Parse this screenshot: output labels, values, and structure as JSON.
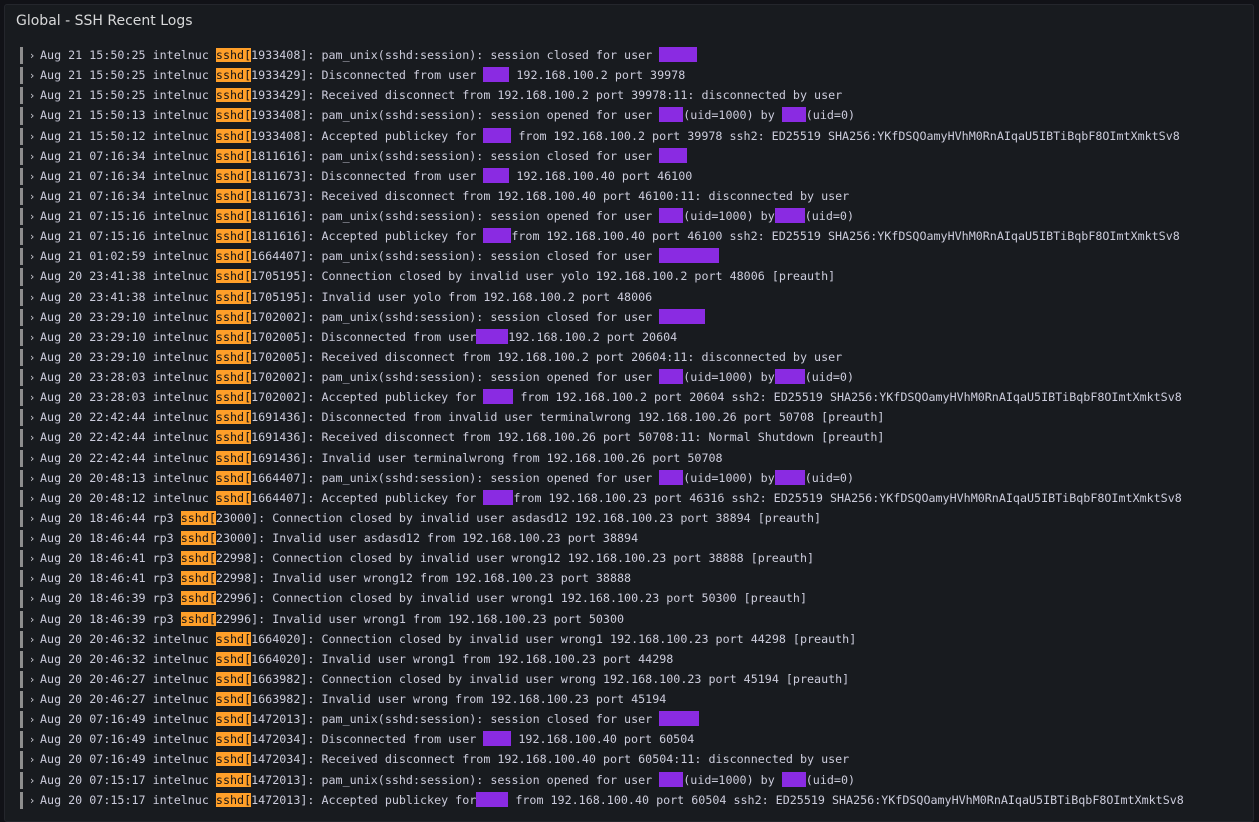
{
  "panel": {
    "title": "Global - SSH Recent Logs"
  },
  "colors": {
    "highlight": "#ff9f29",
    "redaction": "#8a2be2",
    "background": "#181b1f"
  },
  "icons": {
    "row_expand": "chevron-right-icon"
  },
  "logs": [
    {
      "date": "Aug 21 15:50:25",
      "host": "intelnuc",
      "pid": "1933408",
      "parts": [
        {
          "t": "pam_unix(sshd:session): session closed for user "
        },
        {
          "r": 38
        }
      ]
    },
    {
      "date": "Aug 21 15:50:25",
      "host": "intelnuc",
      "pid": "1933429",
      "parts": [
        {
          "t": "Disconnected from user "
        },
        {
          "r": 26
        },
        {
          "t": " 192.168.100.2 port 39978"
        }
      ]
    },
    {
      "date": "Aug 21 15:50:25",
      "host": "intelnuc",
      "pid": "1933429",
      "parts": [
        {
          "t": "Received disconnect from 192.168.100.2 port 39978:11: disconnected by user"
        }
      ]
    },
    {
      "date": "Aug 21 15:50:13",
      "host": "intelnuc",
      "pid": "1933408",
      "parts": [
        {
          "t": "pam_unix(sshd:session): session opened for user "
        },
        {
          "r": 24
        },
        {
          "t": "(uid=1000) by "
        },
        {
          "r": 24
        },
        {
          "t": "(uid=0)"
        }
      ]
    },
    {
      "date": "Aug 21 15:50:12",
      "host": "intelnuc",
      "pid": "1933408",
      "parts": [
        {
          "t": "Accepted publickey for "
        },
        {
          "r": 28
        },
        {
          "t": " from 192.168.100.2 port 39978 ssh2: ED25519 SHA256:YKfDSQOamyHVhM0RnAIqaU5IBTiBqbF8OImtXmktSv8"
        }
      ]
    },
    {
      "date": "Aug 21 07:16:34",
      "host": "intelnuc",
      "pid": "1811616",
      "parts": [
        {
          "t": "pam_unix(sshd:session): session closed for user "
        },
        {
          "r": 28
        }
      ]
    },
    {
      "date": "Aug 21 07:16:34",
      "host": "intelnuc",
      "pid": "1811673",
      "parts": [
        {
          "t": "Disconnected from user "
        },
        {
          "r": 26
        },
        {
          "t": " 192.168.100.40 port 46100"
        }
      ]
    },
    {
      "date": "Aug 21 07:16:34",
      "host": "intelnuc",
      "pid": "1811673",
      "parts": [
        {
          "t": "Received disconnect from 192.168.100.40 port 46100:11: disconnected by user"
        }
      ]
    },
    {
      "date": "Aug 21 07:15:16",
      "host": "intelnuc",
      "pid": "1811616",
      "parts": [
        {
          "t": "pam_unix(sshd:session): session opened for user "
        },
        {
          "r": 24
        },
        {
          "t": "(uid=1000) by"
        },
        {
          "r": 30
        },
        {
          "t": "(uid=0)"
        }
      ]
    },
    {
      "date": "Aug 21 07:15:16",
      "host": "intelnuc",
      "pid": "1811616",
      "parts": [
        {
          "t": "Accepted publickey for "
        },
        {
          "r": 28
        },
        {
          "t": "from 192.168.100.40 port 46100 ssh2: ED25519 SHA256:YKfDSQOamyHVhM0RnAIqaU5IBTiBqbF8OImtXmktSv8"
        }
      ]
    },
    {
      "date": "Aug 21 01:02:59",
      "host": "intelnuc",
      "pid": "1664407",
      "parts": [
        {
          "t": "pam_unix(sshd:session): session closed for user "
        },
        {
          "r": 60
        }
      ]
    },
    {
      "date": "Aug 20 23:41:38",
      "host": "intelnuc",
      "pid": "1705195",
      "parts": [
        {
          "t": "Connection closed by invalid user yolo 192.168.100.2 port 48006 [preauth]"
        }
      ]
    },
    {
      "date": "Aug 20 23:41:38",
      "host": "intelnuc",
      "pid": "1705195",
      "parts": [
        {
          "t": "Invalid user yolo from 192.168.100.2 port 48006"
        }
      ]
    },
    {
      "date": "Aug 20 23:29:10",
      "host": "intelnuc",
      "pid": "1702002",
      "parts": [
        {
          "t": "pam_unix(sshd:session): session closed for user "
        },
        {
          "r": 46
        }
      ]
    },
    {
      "date": "Aug 20 23:29:10",
      "host": "intelnuc",
      "pid": "1702005",
      "parts": [
        {
          "t": "Disconnected from user"
        },
        {
          "r": 32
        },
        {
          "t": "192.168.100.2 port 20604"
        }
      ]
    },
    {
      "date": "Aug 20 23:29:10",
      "host": "intelnuc",
      "pid": "1702005",
      "parts": [
        {
          "t": "Received disconnect from 192.168.100.2 port 20604:11: disconnected by user"
        }
      ]
    },
    {
      "date": "Aug 20 23:28:03",
      "host": "intelnuc",
      "pid": "1702002",
      "parts": [
        {
          "t": "pam_unix(sshd:session): session opened for user "
        },
        {
          "r": 24
        },
        {
          "t": "(uid=1000) by"
        },
        {
          "r": 30
        },
        {
          "t": "(uid=0)"
        }
      ]
    },
    {
      "date": "Aug 20 23:28:03",
      "host": "intelnuc",
      "pid": "1702002",
      "parts": [
        {
          "t": "Accepted publickey for "
        },
        {
          "r": 30
        },
        {
          "t": " from 192.168.100.2 port 20604 ssh2: ED25519 SHA256:YKfDSQOamyHVhM0RnAIqaU5IBTiBqbF8OImtXmktSv8"
        }
      ]
    },
    {
      "date": "Aug 20 22:42:44",
      "host": "intelnuc",
      "pid": "1691436",
      "parts": [
        {
          "t": "Disconnected from invalid user terminalwrong 192.168.100.26 port 50708 [preauth]"
        }
      ]
    },
    {
      "date": "Aug 20 22:42:44",
      "host": "intelnuc",
      "pid": "1691436",
      "parts": [
        {
          "t": "Received disconnect from 192.168.100.26 port 50708:11: Normal Shutdown [preauth]"
        }
      ]
    },
    {
      "date": "Aug 20 22:42:44",
      "host": "intelnuc",
      "pid": "1691436",
      "parts": [
        {
          "t": "Invalid user terminalwrong from 192.168.100.26 port 50708"
        }
      ]
    },
    {
      "date": "Aug 20 20:48:13",
      "host": "intelnuc",
      "pid": "1664407",
      "parts": [
        {
          "t": "pam_unix(sshd:session): session opened for user "
        },
        {
          "r": 24
        },
        {
          "t": "(uid=1000) by"
        },
        {
          "r": 30
        },
        {
          "t": "(uid=0)"
        }
      ]
    },
    {
      "date": "Aug 20 20:48:12",
      "host": "intelnuc",
      "pid": "1664407",
      "parts": [
        {
          "t": "Accepted publickey for "
        },
        {
          "r": 30
        },
        {
          "t": "from 192.168.100.23 port 46316 ssh2: ED25519 SHA256:YKfDSQOamyHVhM0RnAIqaU5IBTiBqbF8OImtXmktSv8"
        }
      ]
    },
    {
      "date": "Aug 20 18:46:44",
      "host": "rp3",
      "pid": "23000",
      "parts": [
        {
          "t": "Connection closed by invalid user asdasd12 192.168.100.23 port 38894 [preauth]"
        }
      ]
    },
    {
      "date": "Aug 20 18:46:44",
      "host": "rp3",
      "pid": "23000",
      "parts": [
        {
          "t": "Invalid user asdasd12 from 192.168.100.23 port 38894"
        }
      ]
    },
    {
      "date": "Aug 20 18:46:41",
      "host": "rp3",
      "pid": "22998",
      "parts": [
        {
          "t": "Connection closed by invalid user wrong12 192.168.100.23 port 38888 [preauth]"
        }
      ]
    },
    {
      "date": "Aug 20 18:46:41",
      "host": "rp3",
      "pid": "22998",
      "parts": [
        {
          "t": "Invalid user wrong12 from 192.168.100.23 port 38888"
        }
      ]
    },
    {
      "date": "Aug 20 18:46:39",
      "host": "rp3",
      "pid": "22996",
      "parts": [
        {
          "t": "Connection closed by invalid user wrong1 192.168.100.23 port 50300 [preauth]"
        }
      ]
    },
    {
      "date": "Aug 20 18:46:39",
      "host": "rp3",
      "pid": "22996",
      "parts": [
        {
          "t": "Invalid user wrong1 from 192.168.100.23 port 50300"
        }
      ]
    },
    {
      "date": "Aug 20 20:46:32",
      "host": "intelnuc",
      "pid": "1664020",
      "parts": [
        {
          "t": "Connection closed by invalid user wrong1 192.168.100.23 port 44298 [preauth]"
        }
      ]
    },
    {
      "date": "Aug 20 20:46:32",
      "host": "intelnuc",
      "pid": "1664020",
      "parts": [
        {
          "t": "Invalid user wrong1 from 192.168.100.23 port 44298"
        }
      ]
    },
    {
      "date": "Aug 20 20:46:27",
      "host": "intelnuc",
      "pid": "1663982",
      "parts": [
        {
          "t": "Connection closed by invalid user wrong 192.168.100.23 port 45194 [preauth]"
        }
      ]
    },
    {
      "date": "Aug 20 20:46:27",
      "host": "intelnuc",
      "pid": "1663982",
      "parts": [
        {
          "t": "Invalid user wrong from 192.168.100.23 port 45194"
        }
      ]
    },
    {
      "date": "Aug 20 07:16:49",
      "host": "intelnuc",
      "pid": "1472013",
      "parts": [
        {
          "t": "pam_unix(sshd:session): session closed for user "
        },
        {
          "r": 40
        }
      ]
    },
    {
      "date": "Aug 20 07:16:49",
      "host": "intelnuc",
      "pid": "1472034",
      "parts": [
        {
          "t": "Disconnected from user "
        },
        {
          "r": 28
        },
        {
          "t": " 192.168.100.40 port 60504"
        }
      ]
    },
    {
      "date": "Aug 20 07:16:49",
      "host": "intelnuc",
      "pid": "1472034",
      "parts": [
        {
          "t": "Received disconnect from 192.168.100.40 port 60504:11: disconnected by user"
        }
      ]
    },
    {
      "date": "Aug 20 07:15:17",
      "host": "intelnuc",
      "pid": "1472013",
      "parts": [
        {
          "t": "pam_unix(sshd:session): session opened for user "
        },
        {
          "r": 24
        },
        {
          "t": "(uid=1000) by "
        },
        {
          "r": 24
        },
        {
          "t": "(uid=0)"
        }
      ]
    },
    {
      "date": "Aug 20 07:15:17",
      "host": "intelnuc",
      "pid": "1472013",
      "parts": [
        {
          "t": "Accepted publickey for"
        },
        {
          "r": 32
        },
        {
          "t": " from 192.168.100.40 port 60504 ssh2: ED25519 SHA256:YKfDSQOamyHVhM0RnAIqaU5IBTiBqbF8OImtXmktSv8"
        }
      ]
    }
  ]
}
